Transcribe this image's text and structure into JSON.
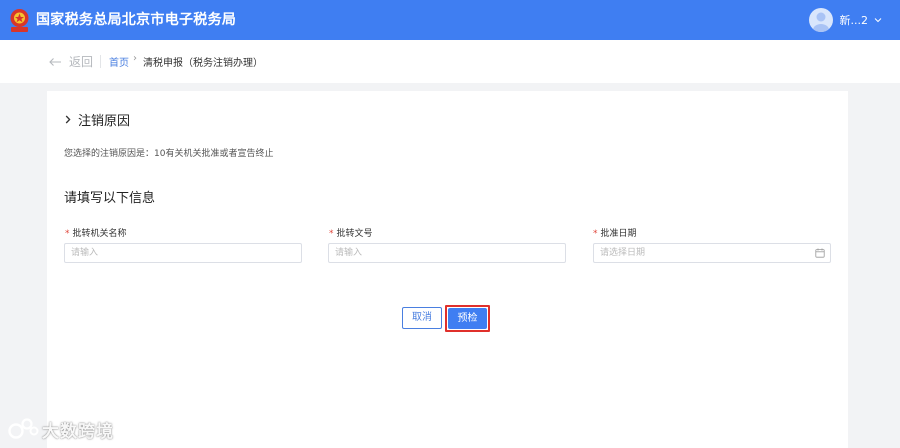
{
  "header": {
    "site_title": "国家税务总局北京市电子税务局",
    "user_name": "新...2"
  },
  "breadcrumb": {
    "back_label": "返回",
    "home_label": "首页",
    "separator": "›",
    "current_label": "清税申报（税务注销办理）"
  },
  "main": {
    "section_title": "注销原因",
    "reason_text": "您选择的注销原因是：10有关机关批准或者宣告终止",
    "form_heading": "请填写以下信息",
    "fields": [
      {
        "required_mark": "*",
        "label": "批转机关名称",
        "placeholder": "请输入"
      },
      {
        "required_mark": "*",
        "label": "批转文号",
        "placeholder": "请输入"
      },
      {
        "required_mark": "*",
        "label": "批准日期",
        "placeholder": "请选择日期"
      }
    ],
    "cancel_label": "取消",
    "precheck_label": "预检"
  },
  "watermark": {
    "text": "大数跨境"
  },
  "colors": {
    "header_blue": "#3f7ef2",
    "link_blue": "#4a7fe0",
    "required_red": "#e0463b",
    "highlight_red": "#e0302b"
  }
}
